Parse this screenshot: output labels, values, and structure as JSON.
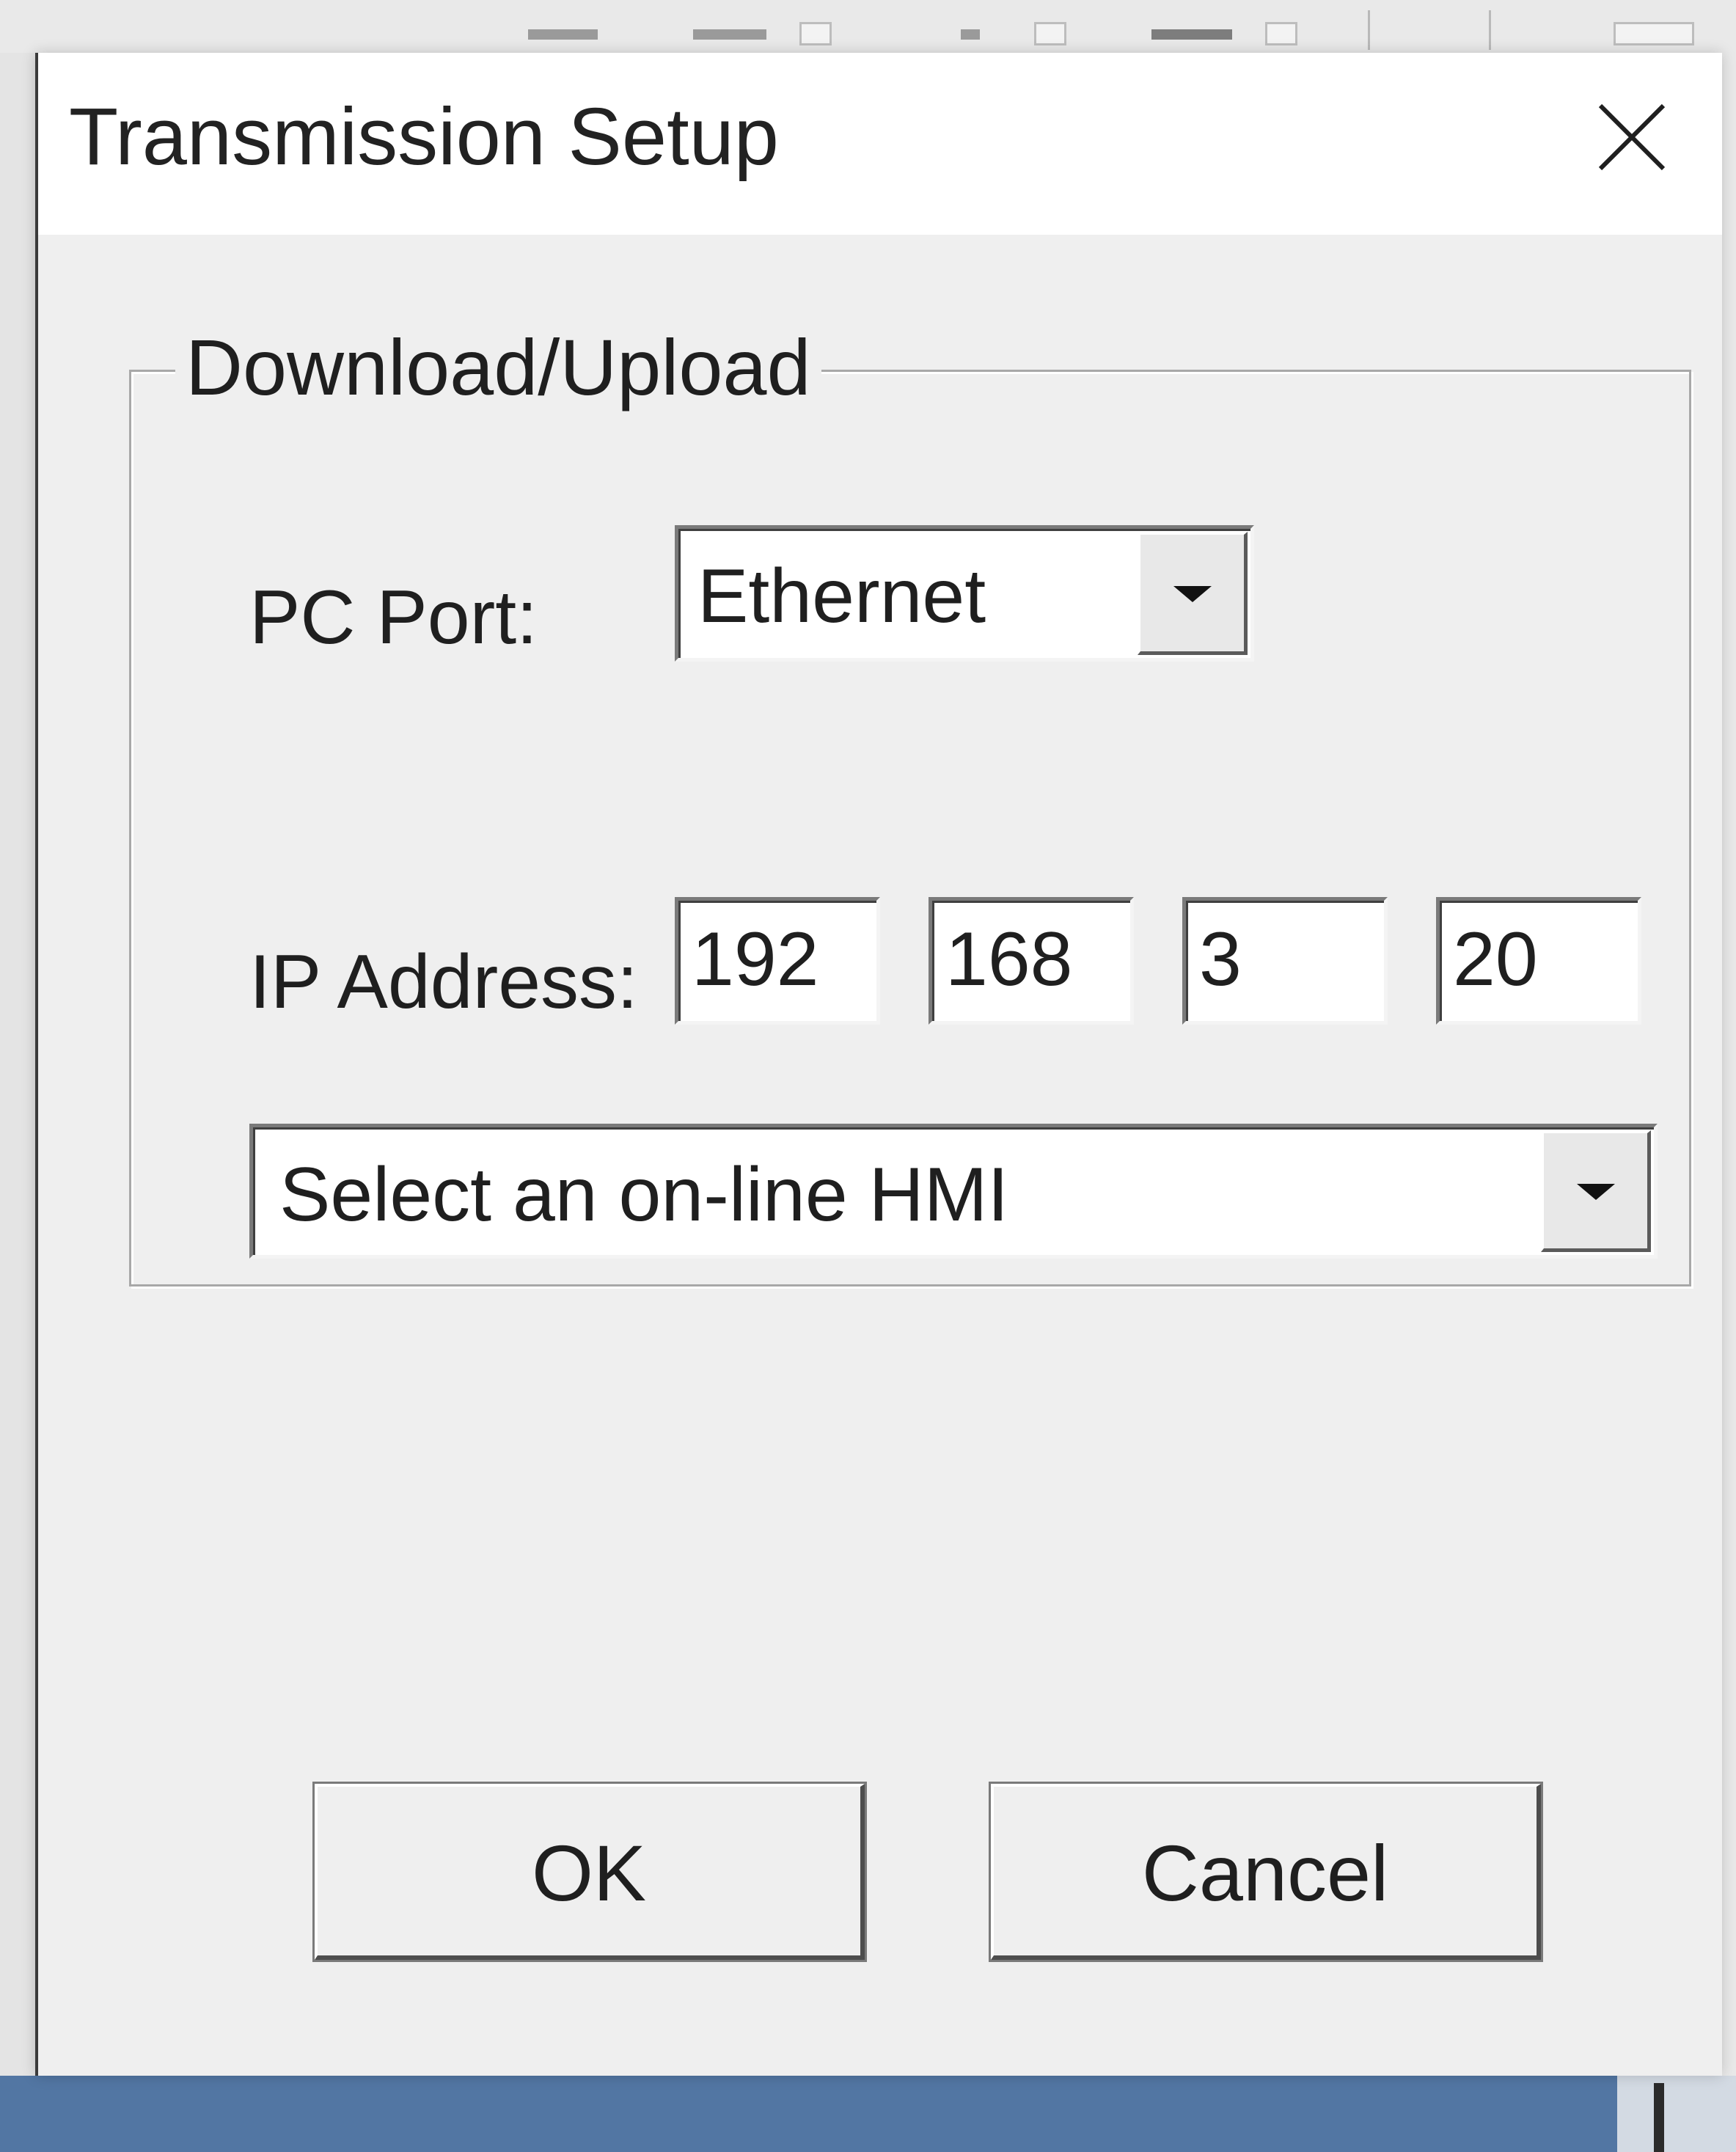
{
  "dialog": {
    "title": "Transmission Setup"
  },
  "group": {
    "legend": "Download/Upload"
  },
  "pc_port": {
    "label": "PC Port:",
    "selected": "Ethernet"
  },
  "ip_address": {
    "label": "IP Address:",
    "octets": [
      "192",
      "168",
      "3",
      "20"
    ]
  },
  "hmi_select": {
    "selected": "Select an on-line HMI"
  },
  "buttons": {
    "ok": "OK",
    "cancel": "Cancel"
  },
  "icons": {
    "close": "close-icon",
    "dropdown": "chevron-down-icon"
  },
  "colors": {
    "taskbar": "#5276a3",
    "dialog_bg": "#efefef",
    "titlebar_bg": "#ffffff"
  }
}
